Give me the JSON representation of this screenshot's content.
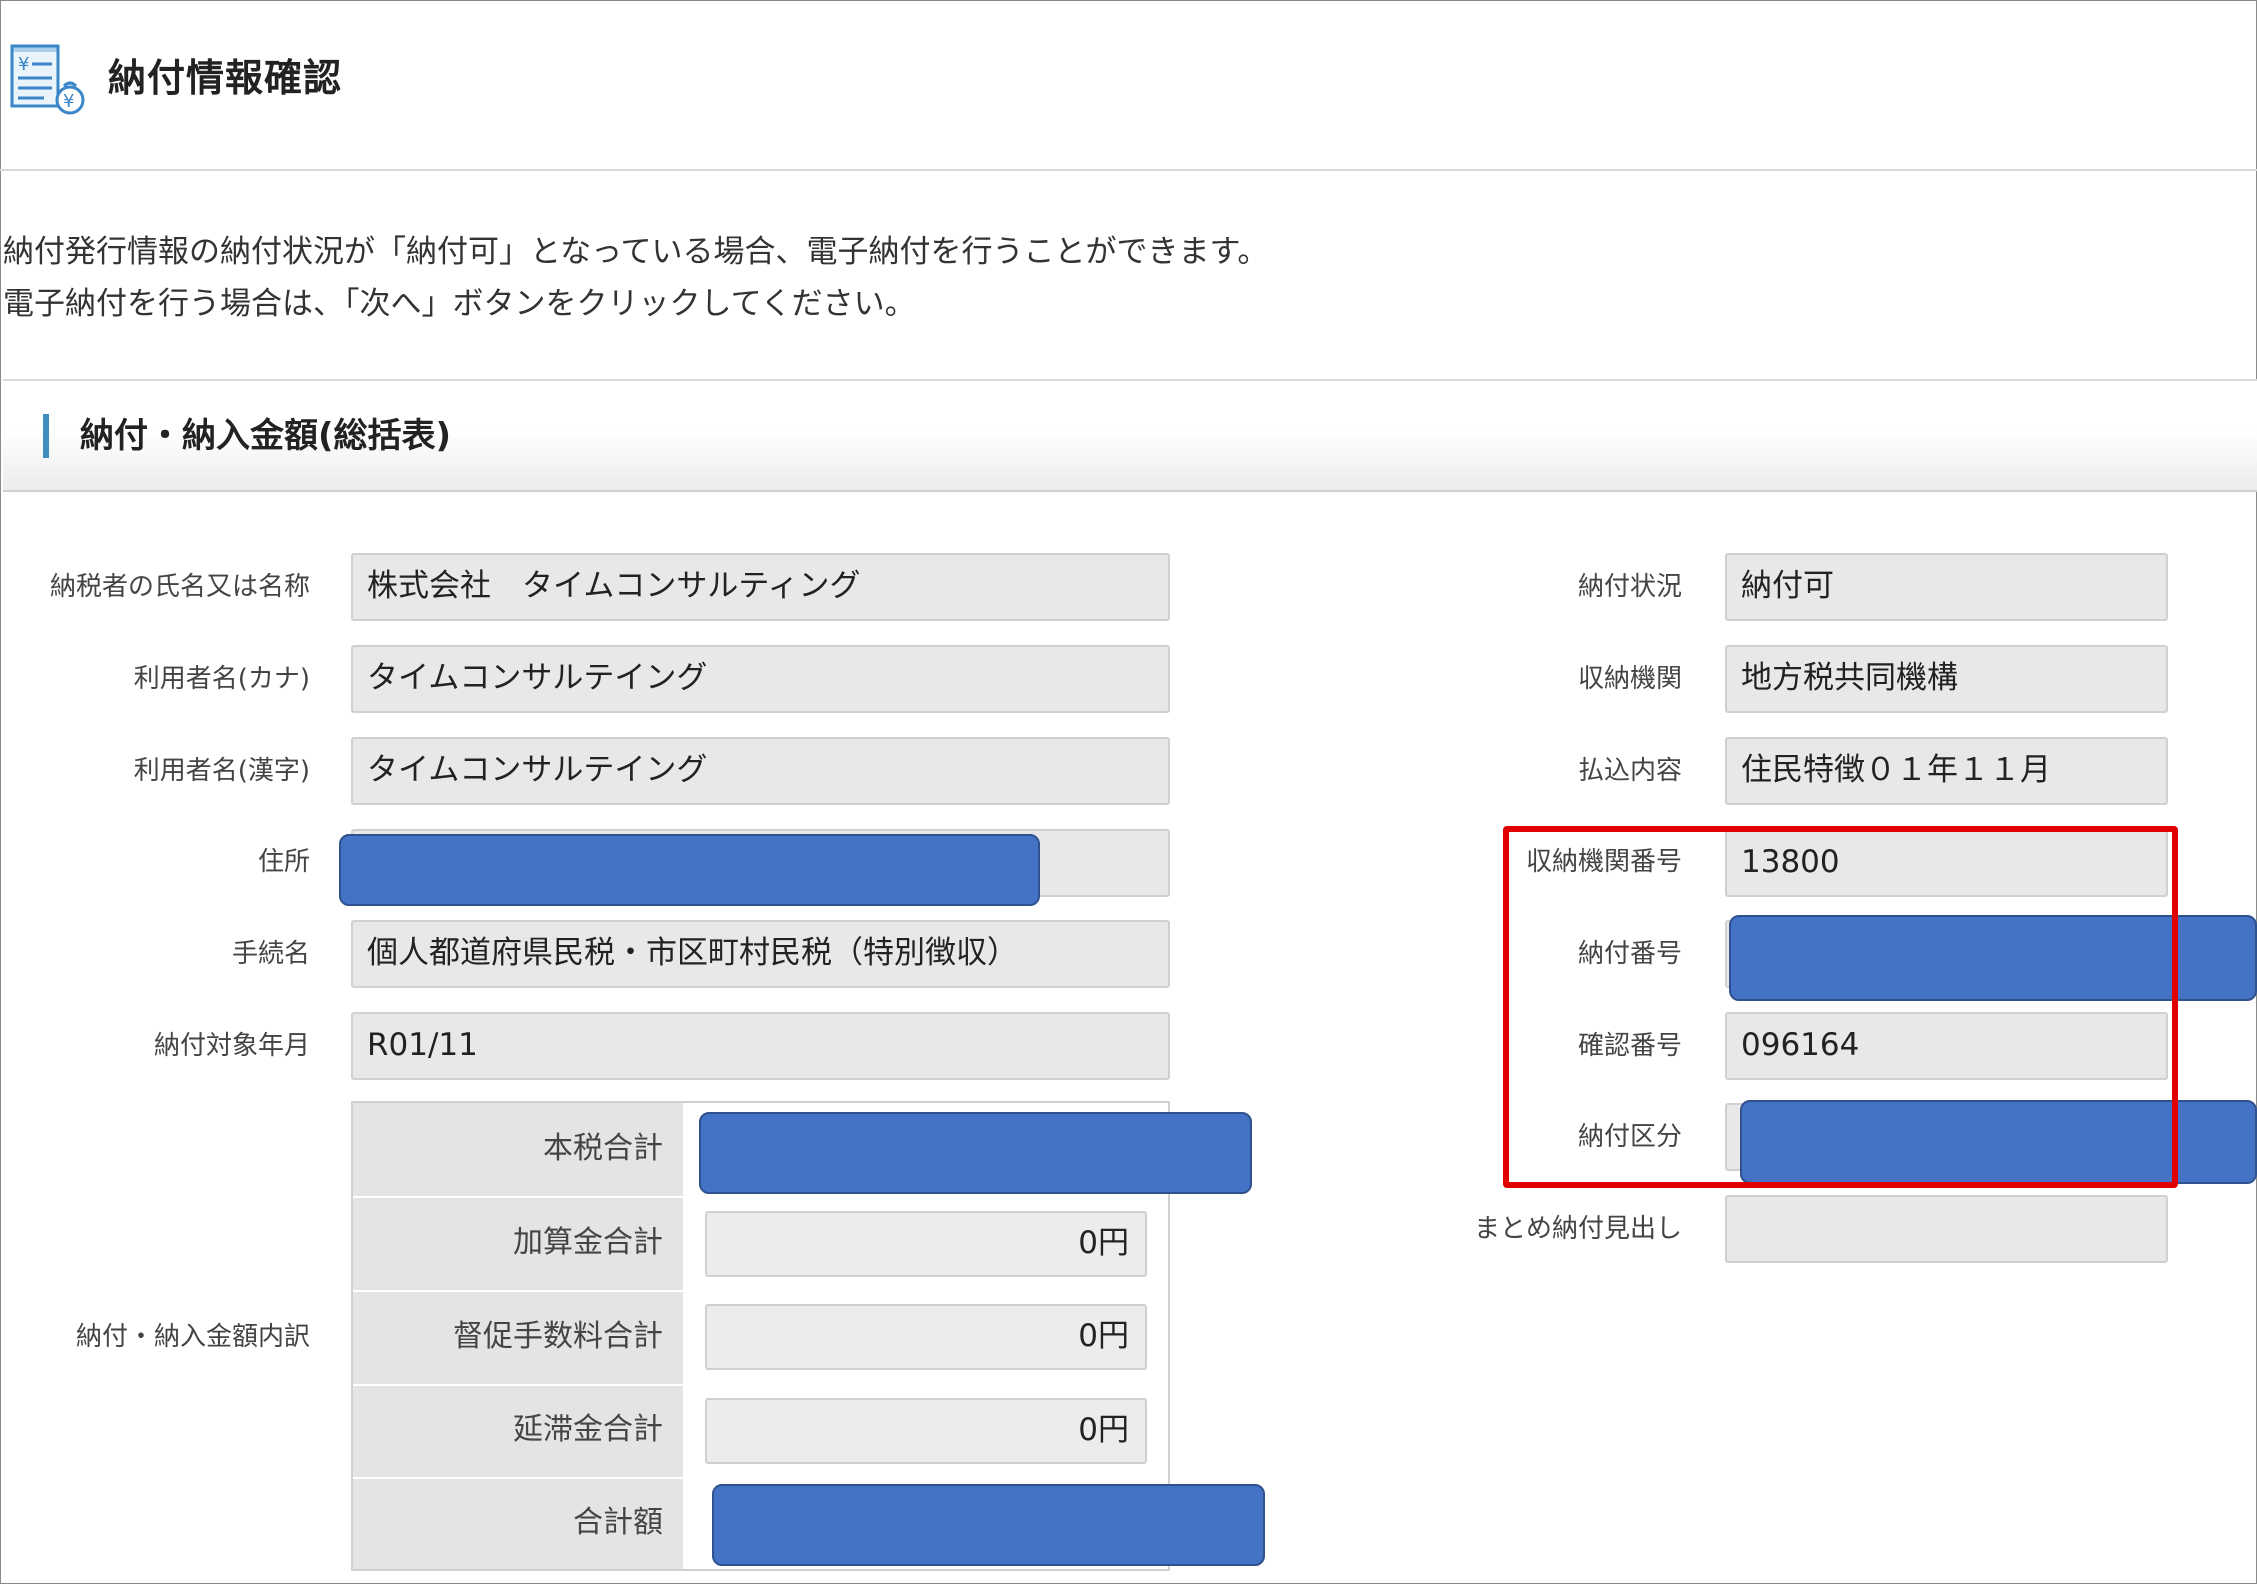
{
  "header": {
    "title": "納付情報確認",
    "icon": "payment-document-icon"
  },
  "notice": {
    "line1": "納付発行情報の納付状況が「納付可」となっている場合、電子納付を行うことができます。",
    "line2": "電子納付を行う場合は、「次へ」ボタンをクリックしてください。"
  },
  "section": {
    "title": "納付・納入金額(総括表)"
  },
  "left_fields": {
    "taxpayer_name": {
      "label": "納税者の氏名又は名称",
      "value": "株式会社　タイムコンサルティング"
    },
    "user_kana": {
      "label": "利用者名(カナ)",
      "value": "タイムコンサルテイング"
    },
    "user_kanji": {
      "label": "利用者名(漢字)",
      "value": "タイムコンサルテイング"
    },
    "address": {
      "label": "住所",
      "value": ""
    },
    "procedure": {
      "label": "手続名",
      "value": "個人都道府県民税・市区町村民税（特別徴収）"
    },
    "target_month": {
      "label": "納付対象年月",
      "value": "R01/11"
    }
  },
  "breakdown": {
    "label": "納付・納入金額内訳",
    "rows": [
      {
        "label": "本税合計",
        "value": ""
      },
      {
        "label": "加算金合計",
        "value": "0円"
      },
      {
        "label": "督促手数料合計",
        "value": "0円"
      },
      {
        "label": "延滞金合計",
        "value": "0円"
      },
      {
        "label": "合計額",
        "value": ""
      }
    ]
  },
  "right_fields": {
    "status": {
      "label": "納付状況",
      "value": "納付可"
    },
    "institution": {
      "label": "収納機関",
      "value": "地方税共同機構"
    },
    "content": {
      "label": "払込内容",
      "value": "住民特徴０１年１１月"
    },
    "institution_no": {
      "label": "収納機関番号",
      "value": "13800"
    },
    "payment_no": {
      "label": "納付番号",
      "value": ""
    },
    "confirm_no": {
      "label": "確認番号",
      "value": "096164"
    },
    "payment_class": {
      "label": "納付区分",
      "value": ""
    },
    "summary_heading": {
      "label": "まとめ納付見出し",
      "value": ""
    }
  },
  "colors": {
    "accent_bar": "#3c8fc0",
    "highlight_border": "#e00000",
    "redaction": "#4472c4"
  }
}
